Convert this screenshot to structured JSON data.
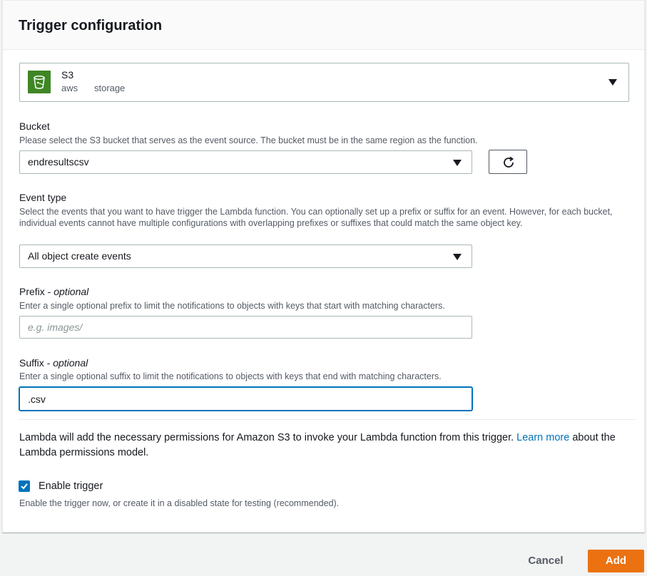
{
  "header": {
    "title": "Trigger configuration"
  },
  "source": {
    "name": "S3",
    "tags": [
      "aws",
      "storage"
    ],
    "icon": "s3-bucket-icon"
  },
  "bucket": {
    "label": "Bucket",
    "description": "Please select the S3 bucket that serves as the event source. The bucket must be in the same region as the function.",
    "value": "endresultscsv",
    "refresh_icon": "refresh-icon"
  },
  "event_type": {
    "label": "Event type",
    "description": "Select the events that you want to have trigger the Lambda function. You can optionally set up a prefix or suffix for an event. However, for each bucket, individual events cannot have multiple configurations with overlapping prefixes or suffixes that could match the same object key.",
    "value": "All object create events"
  },
  "prefix": {
    "label": "Prefix - ",
    "label_optional": "optional",
    "description": "Enter a single optional prefix to limit the notifications to objects with keys that start with matching characters.",
    "placeholder": "e.g. images/",
    "value": ""
  },
  "suffix": {
    "label": "Suffix - ",
    "label_optional": "optional",
    "description": "Enter a single optional suffix to limit the notifications to objects with keys that end with matching characters.",
    "value": ".csv"
  },
  "permissions": {
    "text_before": "Lambda will add the necessary permissions for Amazon S3 to invoke your Lambda function from this trigger. ",
    "link": "Learn more",
    "text_after": " about the Lambda permissions model."
  },
  "enable_trigger": {
    "label": "Enable trigger",
    "checked": true,
    "description": "Enable the trigger now, or create it in a disabled state for testing (recommended)."
  },
  "footer": {
    "cancel_label": "Cancel",
    "add_label": "Add"
  },
  "colors": {
    "accent": "#ec7211",
    "link": "#0073bb",
    "s3_green": "#3f8624"
  }
}
